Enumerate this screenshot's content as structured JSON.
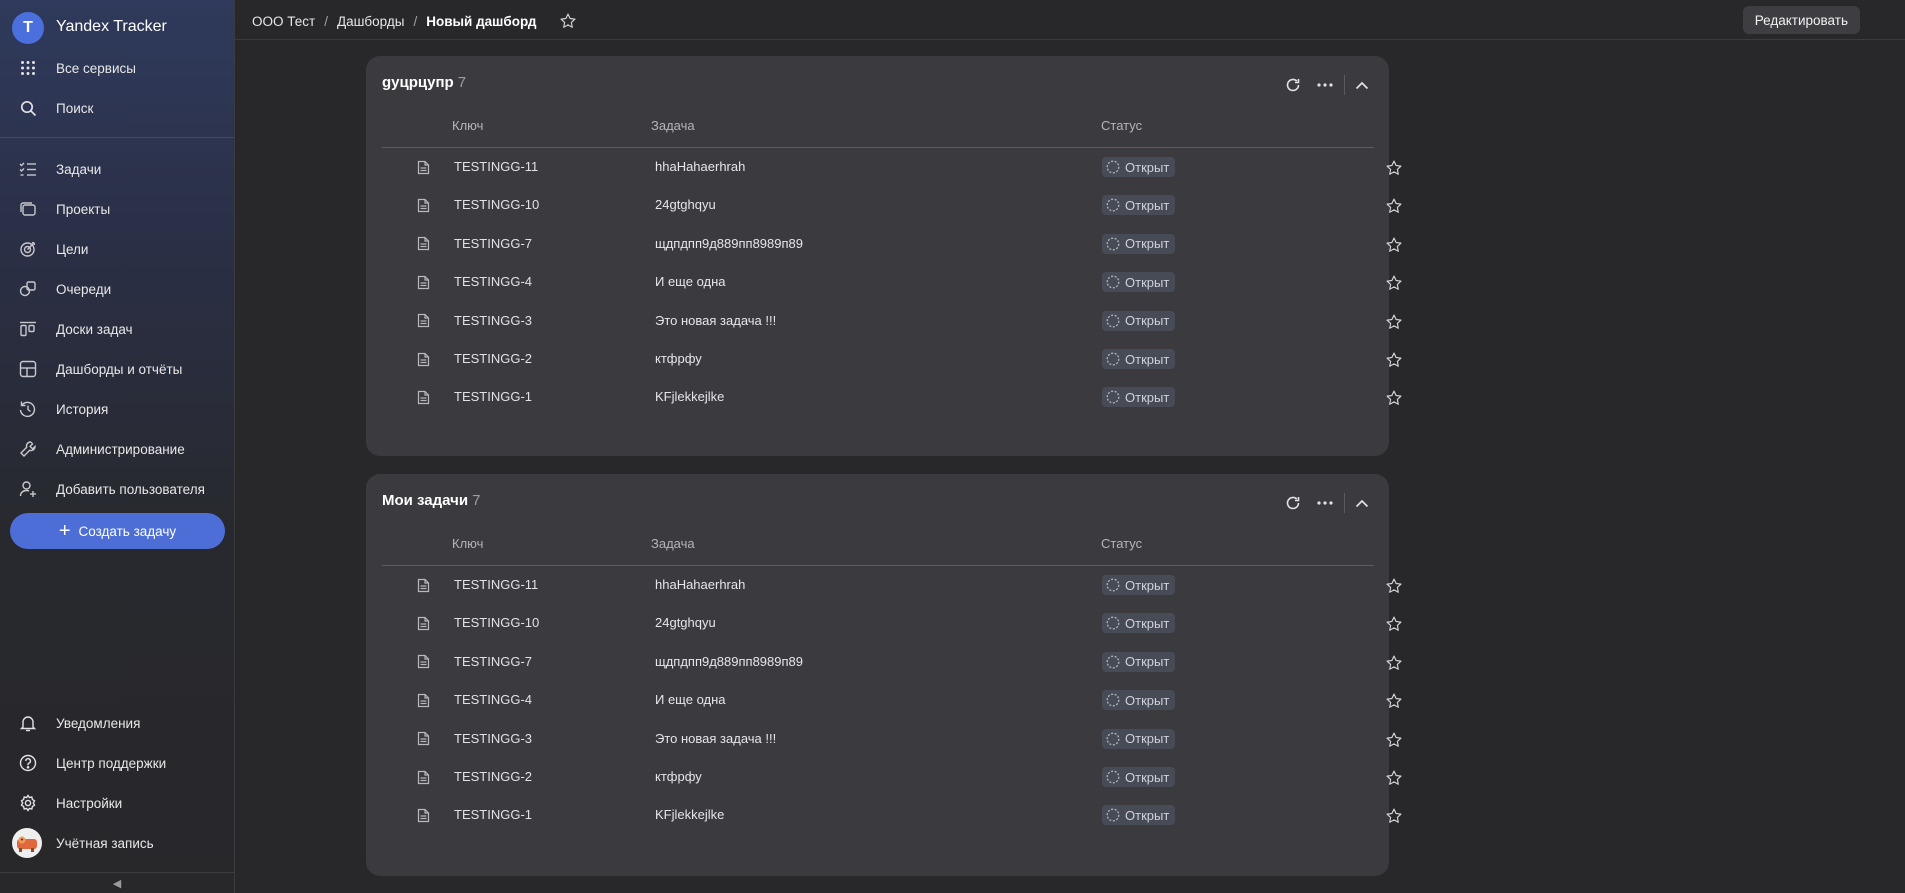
{
  "sidebar": {
    "app_name": "Yandex Tracker",
    "top_items": [
      {
        "label": "Все сервисы",
        "icon": "grid-icon"
      },
      {
        "label": "Поиск",
        "icon": "search-icon"
      }
    ],
    "items": [
      {
        "label": "Задачи",
        "icon": "tasks-icon"
      },
      {
        "label": "Проекты",
        "icon": "projects-icon"
      },
      {
        "label": "Цели",
        "icon": "goals-icon"
      },
      {
        "label": "Очереди",
        "icon": "queues-icon"
      },
      {
        "label": "Доски задач",
        "icon": "boards-icon"
      },
      {
        "label": "Дашборды и отчёты",
        "icon": "dashboards-icon"
      },
      {
        "label": "История",
        "icon": "history-icon"
      },
      {
        "label": "Администрирование",
        "icon": "wrench-icon"
      },
      {
        "label": "Добавить пользователя",
        "icon": "add-user-icon"
      }
    ],
    "create_task_label": "Создать задачу",
    "bottom_items": [
      {
        "label": "Уведомления",
        "icon": "bell-icon"
      },
      {
        "label": "Центр поддержки",
        "icon": "help-icon"
      },
      {
        "label": "Настройки",
        "icon": "gear-icon"
      },
      {
        "label": "Учётная запись",
        "icon": "avatar"
      }
    ],
    "collapse_glyph": "◀"
  },
  "header": {
    "breadcrumbs": [
      "ООО Тест",
      "Дашборды",
      "Новый дашборд"
    ],
    "separator": "/",
    "edit_label": "Редактировать"
  },
  "widgets": [
    {
      "title": "gуцрцупр",
      "count": "7",
      "columns": {
        "key": "Ключ",
        "task": "Задача",
        "status": "Статус"
      },
      "rows": [
        {
          "key": "TESTINGG-11",
          "task": "hhaHahaerhrah",
          "status": "Открыт"
        },
        {
          "key": "TESTINGG-10",
          "task": "24gtghqyu",
          "status": "Открыт"
        },
        {
          "key": "TESTINGG-7",
          "task": "щдпдпп9д889пп8989п89",
          "status": "Открыт"
        },
        {
          "key": "TESTINGG-4",
          "task": "И еще одна",
          "status": "Открыт"
        },
        {
          "key": "TESTINGG-3",
          "task": "Это новая задача !!!",
          "status": "Открыт"
        },
        {
          "key": "TESTINGG-2",
          "task": "ктфрфу",
          "status": "Открыт"
        },
        {
          "key": "TESTINGG-1",
          "task": "KFjlekkejlke",
          "status": "Открыт"
        }
      ]
    },
    {
      "title": "Мои задачи",
      "count": "7",
      "columns": {
        "key": "Ключ",
        "task": "Задача",
        "status": "Статус"
      },
      "rows": [
        {
          "key": "TESTINGG-11",
          "task": "hhaHahaerhrah",
          "status": "Открыт"
        },
        {
          "key": "TESTINGG-10",
          "task": "24gtghqyu",
          "status": "Открыт"
        },
        {
          "key": "TESTINGG-7",
          "task": "щдпдпп9д889пп8989п89",
          "status": "Открыт"
        },
        {
          "key": "TESTINGG-4",
          "task": "И еще одна",
          "status": "Открыт"
        },
        {
          "key": "TESTINGG-3",
          "task": "Это новая задача !!!",
          "status": "Открыт"
        },
        {
          "key": "TESTINGG-2",
          "task": "ктфрфу",
          "status": "Открыт"
        },
        {
          "key": "TESTINGG-1",
          "task": "KFjlekkejlke",
          "status": "Открыт"
        }
      ]
    }
  ],
  "colors": {
    "accent": "#4d6ed7",
    "panel": "#3a3a3f",
    "background": "#28282b",
    "status_badge": "#474b55"
  }
}
